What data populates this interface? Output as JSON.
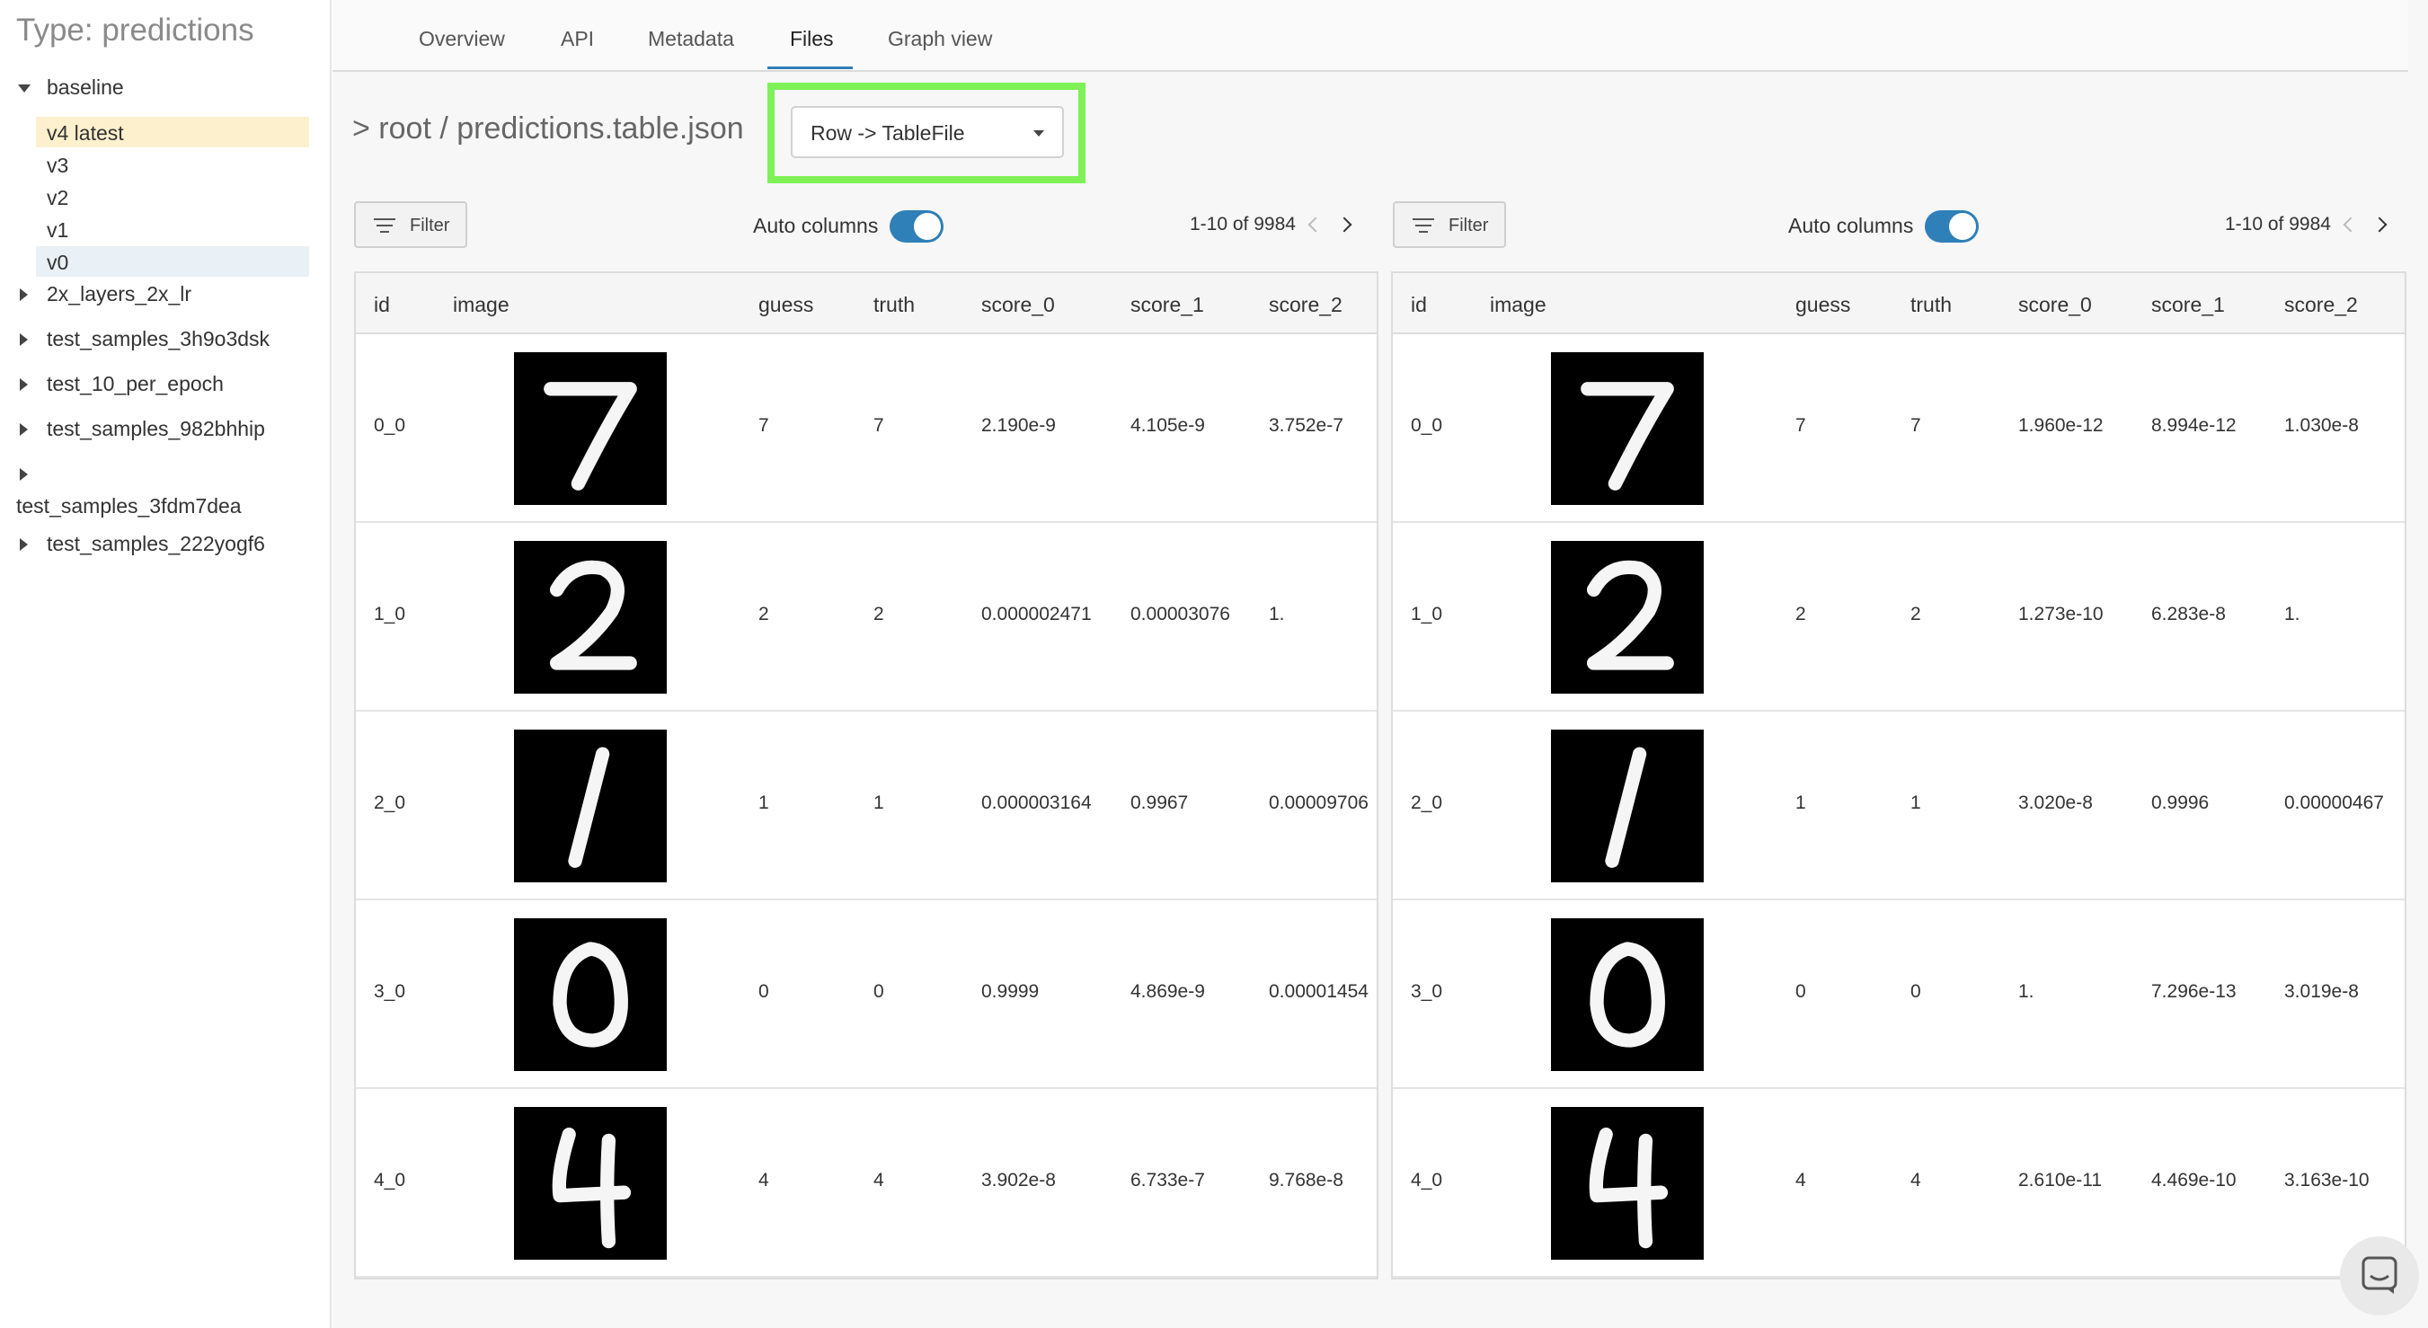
{
  "sidebar": {
    "type_title": "Type: predictions",
    "groups": [
      {
        "label": "baseline"
      },
      {
        "label": "2x_layers_2x_lr"
      },
      {
        "label": "test_samples_3h9o3dsk"
      },
      {
        "label": "test_10_per_epoch"
      },
      {
        "label": "test_samples_982bhhip"
      },
      {
        "label": "test_samples_3fdm7dea"
      },
      {
        "label": "test_samples_222yogf6"
      }
    ],
    "versions": [
      {
        "label": "v4 latest"
      },
      {
        "label": "v3"
      },
      {
        "label": "v2"
      },
      {
        "label": "v1"
      },
      {
        "label": "v0"
      }
    ]
  },
  "tabs": [
    {
      "label": "Overview"
    },
    {
      "label": "API"
    },
    {
      "label": "Metadata"
    },
    {
      "label": "Files"
    },
    {
      "label": "Graph view"
    }
  ],
  "path_title": "> root / predictions.table.json",
  "row_select": {
    "value": "Row -> TableFile"
  },
  "colors": {
    "accent": "#2f7fb8",
    "highlight": "#7ef157",
    "active_version": "#fdf0cc"
  },
  "panels": [
    {
      "filter_label": "Filter",
      "auto_columns_label": "Auto columns",
      "pager": "1-10 of 9984",
      "columns": [
        "id",
        "image",
        "guess",
        "truth",
        "score_0",
        "score_1",
        "score_2"
      ],
      "rows": [
        {
          "id": "0_0",
          "digit": "7",
          "guess": "7",
          "truth": "7",
          "score_0": "2.190e-9",
          "score_1": "4.105e-9",
          "score_2": "3.752e-7"
        },
        {
          "id": "1_0",
          "digit": "2",
          "guess": "2",
          "truth": "2",
          "score_0": "0.000002471",
          "score_1": "0.00003076",
          "score_2": "1."
        },
        {
          "id": "2_0",
          "digit": "1",
          "guess": "1",
          "truth": "1",
          "score_0": "0.000003164",
          "score_1": "0.9967",
          "score_2": "0.00009706"
        },
        {
          "id": "3_0",
          "digit": "0",
          "guess": "0",
          "truth": "0",
          "score_0": "0.9999",
          "score_1": "4.869e-9",
          "score_2": "0.00001454"
        },
        {
          "id": "4_0",
          "digit": "4",
          "guess": "4",
          "truth": "4",
          "score_0": "3.902e-8",
          "score_1": "6.733e-7",
          "score_2": "9.768e-8"
        }
      ]
    },
    {
      "filter_label": "Filter",
      "auto_columns_label": "Auto columns",
      "pager": "1-10 of 9984",
      "columns": [
        "id",
        "image",
        "guess",
        "truth",
        "score_0",
        "score_1",
        "score_2"
      ],
      "rows": [
        {
          "id": "0_0",
          "digit": "7",
          "guess": "7",
          "truth": "7",
          "score_0": "1.960e-12",
          "score_1": "8.994e-12",
          "score_2": "1.030e-8"
        },
        {
          "id": "1_0",
          "digit": "2",
          "guess": "2",
          "truth": "2",
          "score_0": "1.273e-10",
          "score_1": "6.283e-8",
          "score_2": "1."
        },
        {
          "id": "2_0",
          "digit": "1",
          "guess": "1",
          "truth": "1",
          "score_0": "3.020e-8",
          "score_1": "0.9996",
          "score_2": "0.00000467"
        },
        {
          "id": "3_0",
          "digit": "0",
          "guess": "0",
          "truth": "0",
          "score_0": "1.",
          "score_1": "7.296e-13",
          "score_2": "3.019e-8"
        },
        {
          "id": "4_0",
          "digit": "4",
          "guess": "4",
          "truth": "4",
          "score_0": "2.610e-11",
          "score_1": "4.469e-10",
          "score_2": "3.163e-10"
        }
      ]
    }
  ]
}
